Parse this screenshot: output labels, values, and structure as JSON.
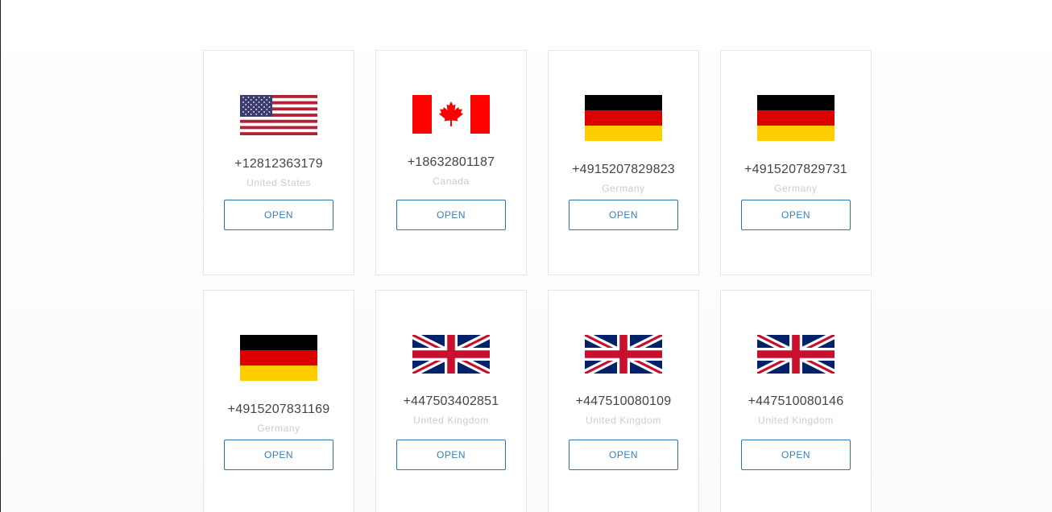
{
  "cards": [
    {
      "flag": "us-flag-icon",
      "number": "+12812363179",
      "country": "United States",
      "button": "OPEN"
    },
    {
      "flag": "ca-flag-icon",
      "number": "+18632801187",
      "country": "Canada",
      "button": "OPEN"
    },
    {
      "flag": "de-flag-icon",
      "number": "+4915207829823",
      "country": "Germany",
      "button": "OPEN"
    },
    {
      "flag": "de-flag-icon",
      "number": "+4915207829731",
      "country": "Germany",
      "button": "OPEN"
    },
    {
      "flag": "de-flag-icon",
      "number": "+4915207831169",
      "country": "Germany",
      "button": "OPEN"
    },
    {
      "flag": "gb-flag-icon",
      "number": "+447503402851",
      "country": "United Kingdom",
      "button": "OPEN"
    },
    {
      "flag": "gb-flag-icon",
      "number": "+447510080109",
      "country": "United Kingdom",
      "button": "OPEN"
    },
    {
      "flag": "gb-flag-icon",
      "number": "+447510080146",
      "country": "United Kingdom",
      "button": "OPEN"
    }
  ],
  "colors": {
    "button_border": "#2a74b0",
    "button_text": "#3a7fbd",
    "number_text": "#444444",
    "country_text": "#c7ccd3"
  }
}
